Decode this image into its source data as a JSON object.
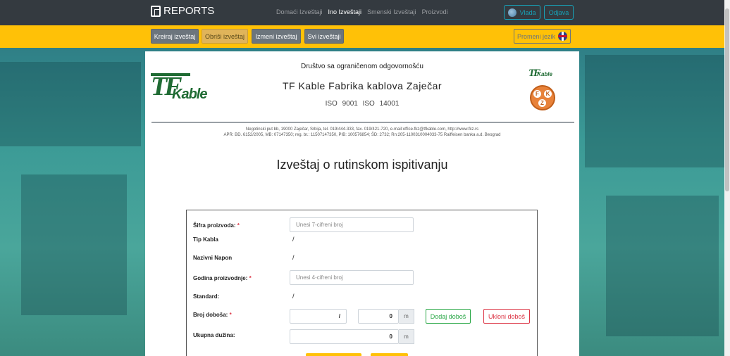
{
  "navbar": {
    "brand": "REPORTS",
    "links": [
      {
        "label": "Domaći Izveštaji",
        "active": false
      },
      {
        "label": "Ino Izveštaji",
        "active": true
      },
      {
        "label": "Smenski Izveštaji",
        "active": false
      },
      {
        "label": "Proizvodi",
        "active": false
      }
    ],
    "user": "Vlada",
    "logout": "Odjava"
  },
  "actionbar": {
    "buttons": [
      {
        "label": "Kreiraj izveštaj"
      },
      {
        "label": "Obriši izveštaj"
      },
      {
        "label": "Izmeni izveštaj"
      },
      {
        "label": "Svi izveštaji"
      }
    ],
    "language_button": "Promeni jezik"
  },
  "document": {
    "company_type": "Društvo sa ograničenom odgovornošću",
    "company_name": "TF Kable Fabrika kablova Zaječar",
    "iso": "ISO 9001    ISO 14001",
    "address_line1": "Negotinski put bb, 19000 Zaječar, Srbija, tel. 019/444-333, fax. 019/421-720, e-mail:office.fkz@tfkable.com, http://www.fkz.rs",
    "address_line2": "APR: BD. 6152/2005, MB: 07147350; reg. br.: 11507147350, PIB: 100576854; ŠD: 2732; Rn:205-1100310004033-75 Raiffeisen banka a.d. Beograd",
    "logo_left_tf": "TF",
    "logo_left_kable": "Kable",
    "logo_right_tf": "TF",
    "logo_right_kable": "Kable",
    "seal_letters": [
      "F",
      "K",
      "Z"
    ],
    "report_title": "Izveštaj o rutinskom ispitivanju"
  },
  "form": {
    "sifra_label": "Šifra proizvoda:",
    "sifra_placeholder": "Unesi 7-cifreni broj",
    "tip_label": "Tip Kabla",
    "tip_value": "/",
    "napon_label": "Nazivni Napon",
    "napon_value": "/",
    "godina_label": "Godina proizvodnje:",
    "godina_placeholder": "Unesi 4-cifreni broj",
    "standard_label": "Standard:",
    "standard_value": "/",
    "doboi_label": "Broj doboša:",
    "doboi_value": "/",
    "doboi_count": "0",
    "unit": "m",
    "dodaj": "Dodaj doboš",
    "ukloni": "Ukloni doboš",
    "duzina_label": "Ukupna dužina:",
    "duzina_value": "0",
    "required_mark": "*"
  },
  "colors": {
    "navbar": "#343a40",
    "actionbar": "#ffc107",
    "accent_info": "#17a2b8",
    "logo_green": "#1f6b33"
  }
}
